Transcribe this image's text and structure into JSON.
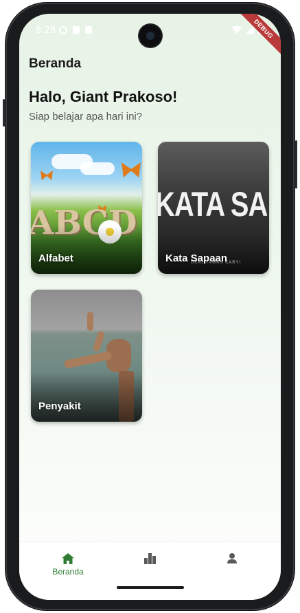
{
  "status_bar": {
    "time": "8:28"
  },
  "debug_banner": "DEBUG",
  "app_bar": {
    "title": "Beranda"
  },
  "header": {
    "greeting": "Halo, Giant Prakoso!",
    "subtitle": "Siap belajar apa hari ini?"
  },
  "categories": [
    {
      "label": "Alfabet",
      "image_text": "ABCD"
    },
    {
      "label": "Kata Sapaan",
      "image_text": "KATA SAPAAN",
      "image_subtext": "UKAL TAMAN KARYI"
    },
    {
      "label": "Penyakit"
    }
  ],
  "bottom_nav": {
    "items": [
      {
        "label": "Beranda",
        "icon": "home-icon",
        "active": true
      },
      {
        "label": "",
        "icon": "bar-chart-icon",
        "active": false
      },
      {
        "label": "",
        "icon": "person-icon",
        "active": false
      }
    ]
  },
  "colors": {
    "accent": "#2e7d32",
    "debug": "#b93a3a"
  }
}
